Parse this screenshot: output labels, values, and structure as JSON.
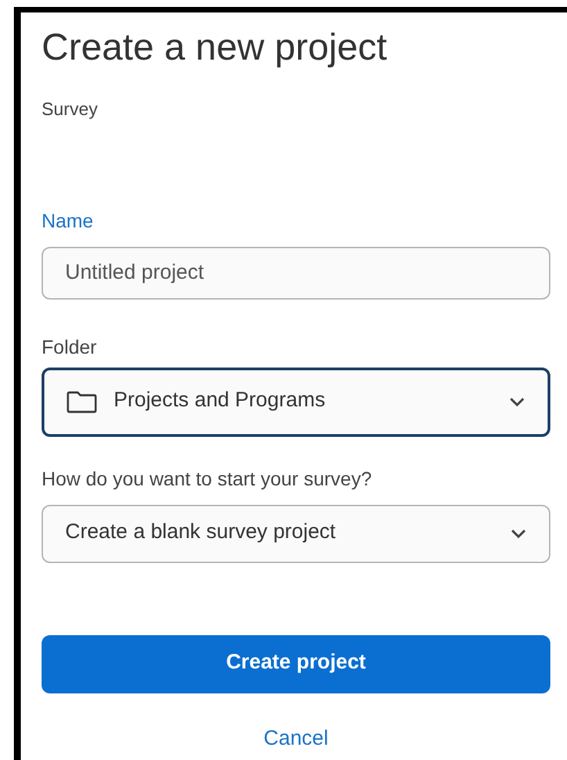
{
  "title": "Create a new project",
  "subtitle": "Survey",
  "name_field": {
    "label": "Name",
    "placeholder": "Untitled project"
  },
  "folder_select": {
    "label": "Folder",
    "value": "Projects and Programs",
    "focused": true
  },
  "start_select": {
    "label": "How do you want to start your survey?",
    "value": "Create a blank survey project",
    "focused": false
  },
  "buttons": [
    {
      "label": "Create project",
      "kind": "primary"
    },
    {
      "label": "Cancel",
      "kind": "link"
    }
  ]
}
